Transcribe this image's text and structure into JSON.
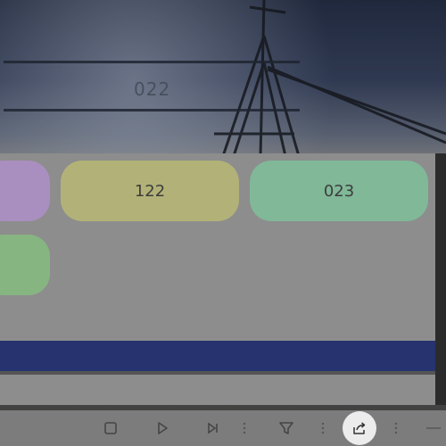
{
  "display": {
    "value": "022"
  },
  "tiles": [
    {
      "label": "",
      "color": "#b99fd4"
    },
    {
      "label": "122",
      "color": "#c9c98a"
    },
    {
      "label": "023",
      "color": "#8fceac"
    },
    {
      "label": "",
      "color": "#95c98f"
    }
  ],
  "toolbar": {
    "items": [
      "stop-icon",
      "play-icon",
      "skip-next-icon",
      "separator",
      "filter-icon",
      "separator",
      "share-icon",
      "separator",
      "more-icon"
    ]
  },
  "colors": {
    "panel": "#8d8d8d",
    "accent_bar": "#26336e",
    "share_button_bg": "#ececec"
  }
}
